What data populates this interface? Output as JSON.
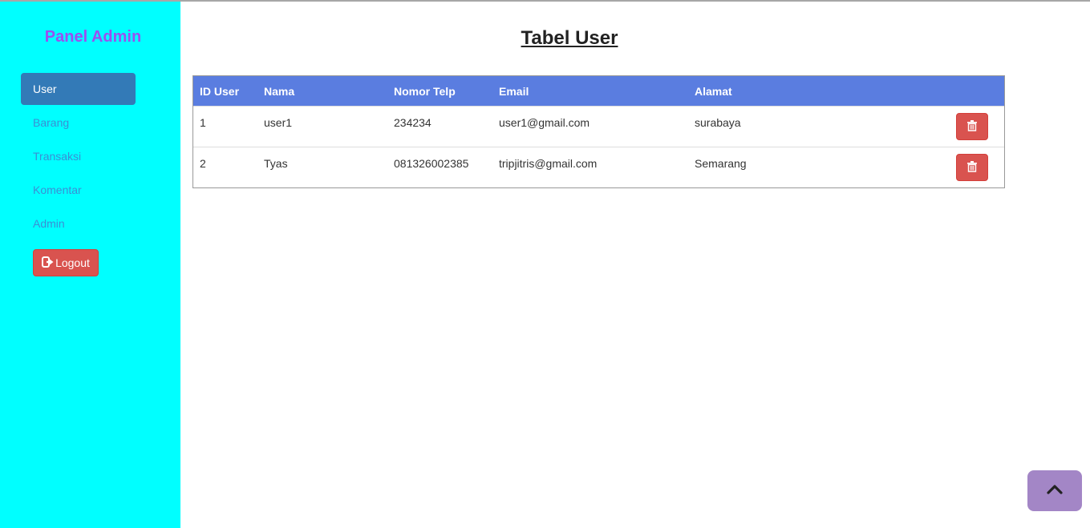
{
  "sidebar": {
    "brand": "Panel Admin",
    "items": [
      {
        "label": "User",
        "active": true
      },
      {
        "label": "Barang",
        "active": false
      },
      {
        "label": "Transaksi",
        "active": false
      },
      {
        "label": "Komentar",
        "active": false
      },
      {
        "label": "Admin",
        "active": false
      }
    ],
    "logout_label": "Logout",
    "logout_icon": "sign-out-icon"
  },
  "main": {
    "title": "Tabel User",
    "columns": [
      "ID User",
      "Nama",
      "Nomor Telp",
      "Email",
      "Alamat"
    ],
    "rows": [
      [
        "1",
        "user1",
        "234234",
        "user1@gmail.com",
        "surabaya"
      ],
      [
        "2",
        "Tyas",
        "081326002385",
        "tripjitris@gmail.com",
        "Semarang"
      ]
    ],
    "delete_icon": "trash-icon"
  },
  "scroll_top_icon": "chevron-up-icon",
  "colors": {
    "sidebar_bg": "#00ffff",
    "brand": "#9b4ff0",
    "active_nav": "#337ab7",
    "table_header": "#5a7de0",
    "danger": "#d9534f",
    "scroll_top": "#a386c6"
  }
}
